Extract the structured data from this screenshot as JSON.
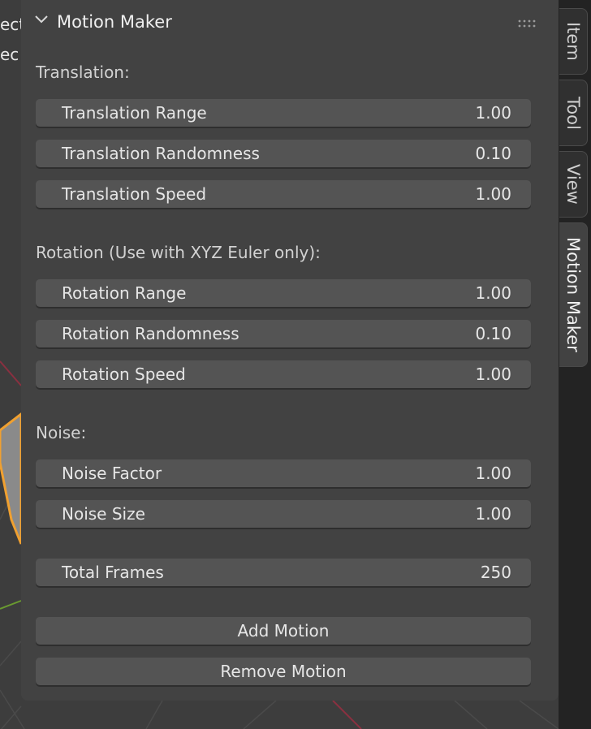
{
  "viewport": {
    "partial_text_1": "ect",
    "partial_text_2": "ec"
  },
  "tabs": [
    {
      "label": "Item"
    },
    {
      "label": "Tool"
    },
    {
      "label": "View"
    },
    {
      "label": "Motion Maker",
      "active": true
    }
  ],
  "panel": {
    "title": "Motion Maker",
    "sections": {
      "translation": {
        "label": "Translation:",
        "fields": [
          {
            "label": "Translation Range",
            "value": "1.00"
          },
          {
            "label": "Translation Randomness",
            "value": "0.10"
          },
          {
            "label": "Translation Speed",
            "value": "1.00"
          }
        ]
      },
      "rotation": {
        "label": "Rotation (Use with XYZ Euler only):",
        "fields": [
          {
            "label": "Rotation Range",
            "value": "1.00"
          },
          {
            "label": "Rotation Randomness",
            "value": "0.10"
          },
          {
            "label": "Rotation Speed",
            "value": "1.00"
          }
        ]
      },
      "noise": {
        "label": "Noise:",
        "fields": [
          {
            "label": "Noise Factor",
            "value": "1.00"
          },
          {
            "label": "Noise Size",
            "value": "1.00"
          }
        ]
      }
    },
    "total_frames": {
      "label": "Total Frames",
      "value": "250"
    },
    "add_motion_label": "Add Motion",
    "remove_motion_label": "Remove Motion"
  },
  "colors": {
    "panel_bg": "#424242",
    "field_bg": "#545454",
    "selection_outline": "#f0a030",
    "axis_red": "#a03040",
    "axis_green": "#6a9a30"
  }
}
